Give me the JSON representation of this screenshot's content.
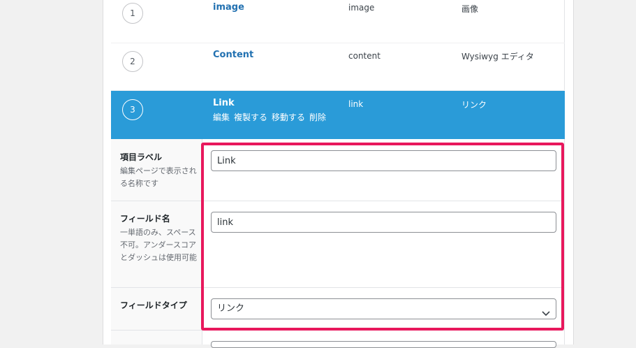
{
  "fields": [
    {
      "order": "1",
      "label": "image",
      "name": "image",
      "type": "画像"
    },
    {
      "order": "2",
      "label": "Content",
      "name": "content",
      "type": "Wysiwyg エディタ"
    },
    {
      "order": "3",
      "label": "Link",
      "name": "link",
      "type": "リンク"
    }
  ],
  "row_actions": [
    "編集",
    "複製する",
    "移動する",
    "削除"
  ],
  "settings": {
    "label": {
      "title": "項目ラベル",
      "desc": "編集ページで表示される名称です",
      "value": "Link"
    },
    "name": {
      "title": "フィールド名",
      "desc": "一単語のみ、スペース不可。アンダースコアとダッシュは使用可能",
      "value": "link"
    },
    "type": {
      "title": "フィールドタイプ",
      "value": "リンク"
    }
  },
  "colors": {
    "active_row": "#2a9bd8",
    "highlight": "#e8185c",
    "link": "#2271b1"
  }
}
